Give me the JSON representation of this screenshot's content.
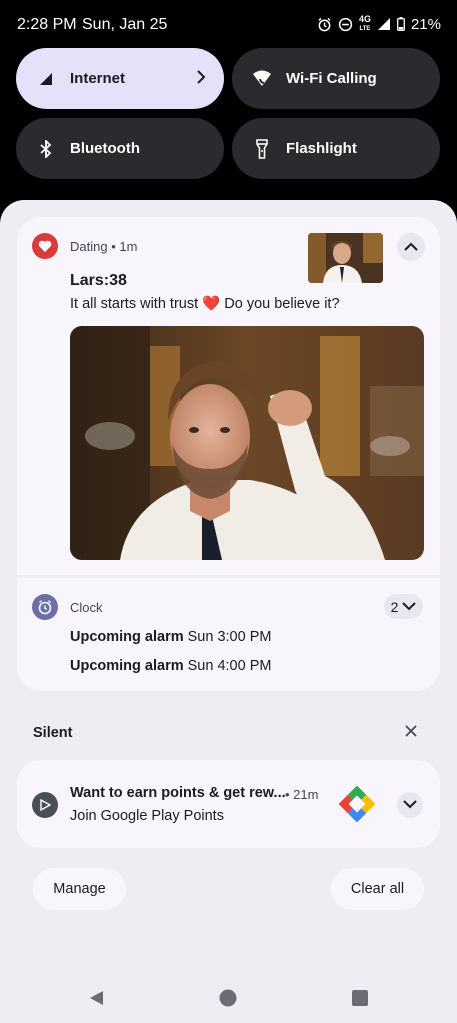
{
  "status_bar": {
    "time": "2:28 PM",
    "date": "Sun, Jan 25",
    "network": "4G",
    "network_sub": "LTE",
    "battery": "21%",
    "icons": [
      "alarm-icon",
      "dnd-icon",
      "signal-icon",
      "battery-icon"
    ]
  },
  "quick_settings": {
    "tiles": [
      {
        "label": "Internet",
        "state": "on",
        "icon": "signal-icon"
      },
      {
        "label": "Wi-Fi Calling",
        "state": "off",
        "icon": "wifi-calling-icon"
      },
      {
        "label": "Bluetooth",
        "state": "off",
        "icon": "bluetooth-icon"
      },
      {
        "label": "Flashlight",
        "state": "off",
        "icon": "flashlight-icon"
      }
    ]
  },
  "notifications": {
    "dating": {
      "app": "Dating",
      "time": "1m",
      "title": "Lars:38",
      "body_before": "It all starts with trust",
      "emoji": "❤️",
      "body_after": "Do you believe it?",
      "accent": "#d93a3a"
    },
    "clock": {
      "app": "Clock",
      "count": "2",
      "rows": [
        {
          "label": "Upcoming alarm",
          "value": "Sun 3:00 PM"
        },
        {
          "label": "Upcoming alarm",
          "value": "Sun 4:00 PM"
        }
      ],
      "accent": "#6b6ea8"
    },
    "silent_label": "Silent",
    "play": {
      "title": "Want to earn points & get rew...",
      "time": "• 21m",
      "body": "Join Google Play Points",
      "accent": "#4a4f57"
    }
  },
  "actions": {
    "manage": "Manage",
    "clear_all": "Clear all"
  },
  "colors": {
    "shade_bg": "#efedf3",
    "card_bg": "#f8f6fc",
    "tile_on": "#e6e1f8",
    "tile_off": "#2b2a2e"
  }
}
